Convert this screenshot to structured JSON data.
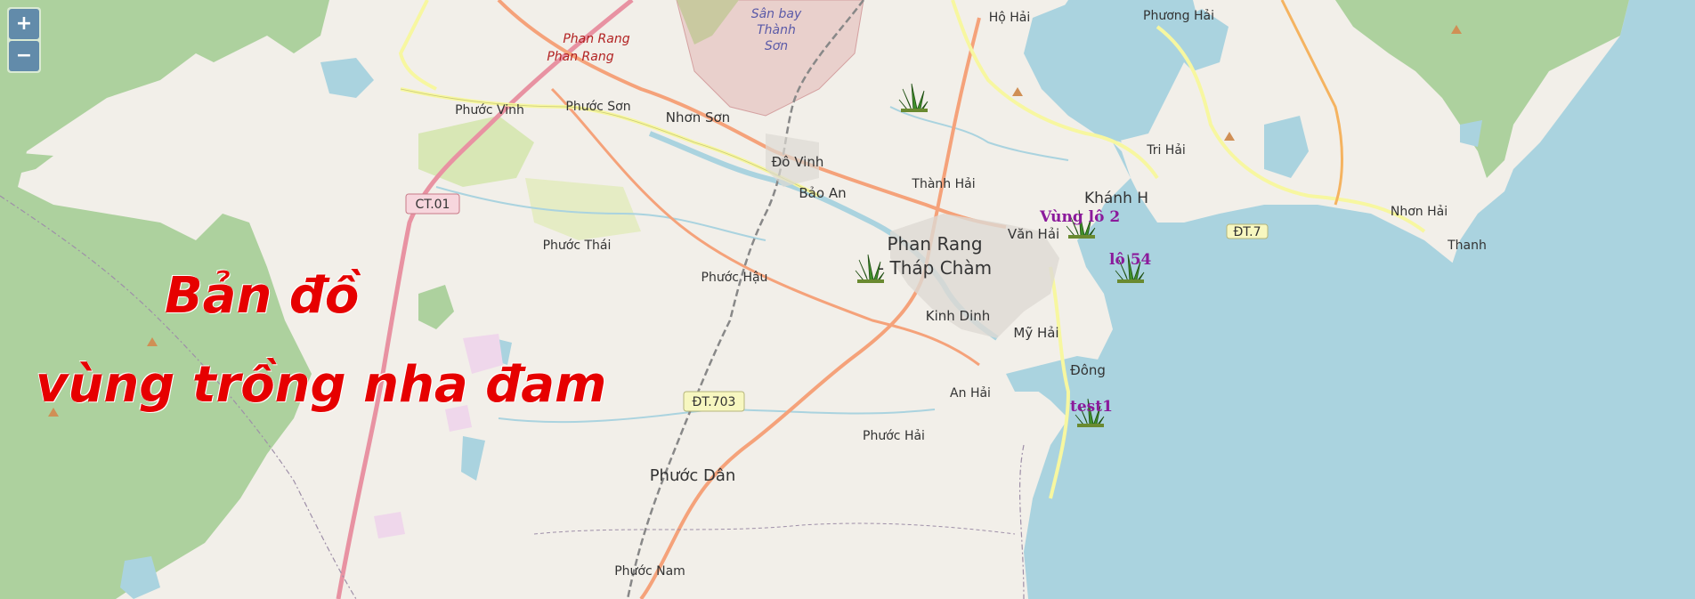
{
  "zoom": {
    "in_label": "+",
    "out_label": "−"
  },
  "title": {
    "line1": "Bản đồ",
    "line2": "vùng trồng nha đam"
  },
  "places": {
    "phan_rang_1": "Phan Rang",
    "phan_rang_2": "Phan Rang",
    "san_bay_1": "Sân bay",
    "san_bay_2": "Thành",
    "san_bay_3": "Sơn",
    "ho_hai": "Hộ Hải",
    "phuong_hai": "Phương Hải",
    "phuoc_vinh": "Phước Vinh",
    "phuoc_son": "Phước Sơn",
    "nhon_son": "Nhơn Sơn",
    "do_vinh": "Đô Vinh",
    "bao_an": "Bảo An",
    "thanh_hai": "Thành Hải",
    "tri_hai": "Tri Hải",
    "khanh_h": "Khánh H",
    "van_hai": "Văn Hải",
    "nhon_hai": "Nhơn Hải",
    "thanh_edge": "Thanh",
    "phuoc_thai": "Phước Thái",
    "phuoc_hau": "Phước Hậu",
    "prtc_1": "Phan Rang",
    "prtc_2": "- Tháp Chàm",
    "kinh_dinh": "Kinh Dinh",
    "my_hai": "Mỹ Hải",
    "dong": "Đông",
    "an_hai": "An Hải",
    "phuoc_hai": "Phước Hải",
    "phuoc_dan": "Phước Dân",
    "phuoc_nam": "Phước Nam"
  },
  "roads": {
    "ct01": "CT.01",
    "dt703": "ĐT.703",
    "dt7x": "ĐT.7"
  },
  "markers": [
    {
      "label": ""
    },
    {
      "label": "Vùng lô 2"
    },
    {
      "label": "lô 54"
    },
    {
      "label": ""
    },
    {
      "label": "test1"
    }
  ],
  "colors": {
    "sea": "#aad3df",
    "land": "#f2efe9",
    "forest": "#add19e",
    "primary_road": "#f5a27a",
    "trunk_road": "#e892a2",
    "marker_label": "#8b1a9b",
    "title": "#e60000"
  }
}
